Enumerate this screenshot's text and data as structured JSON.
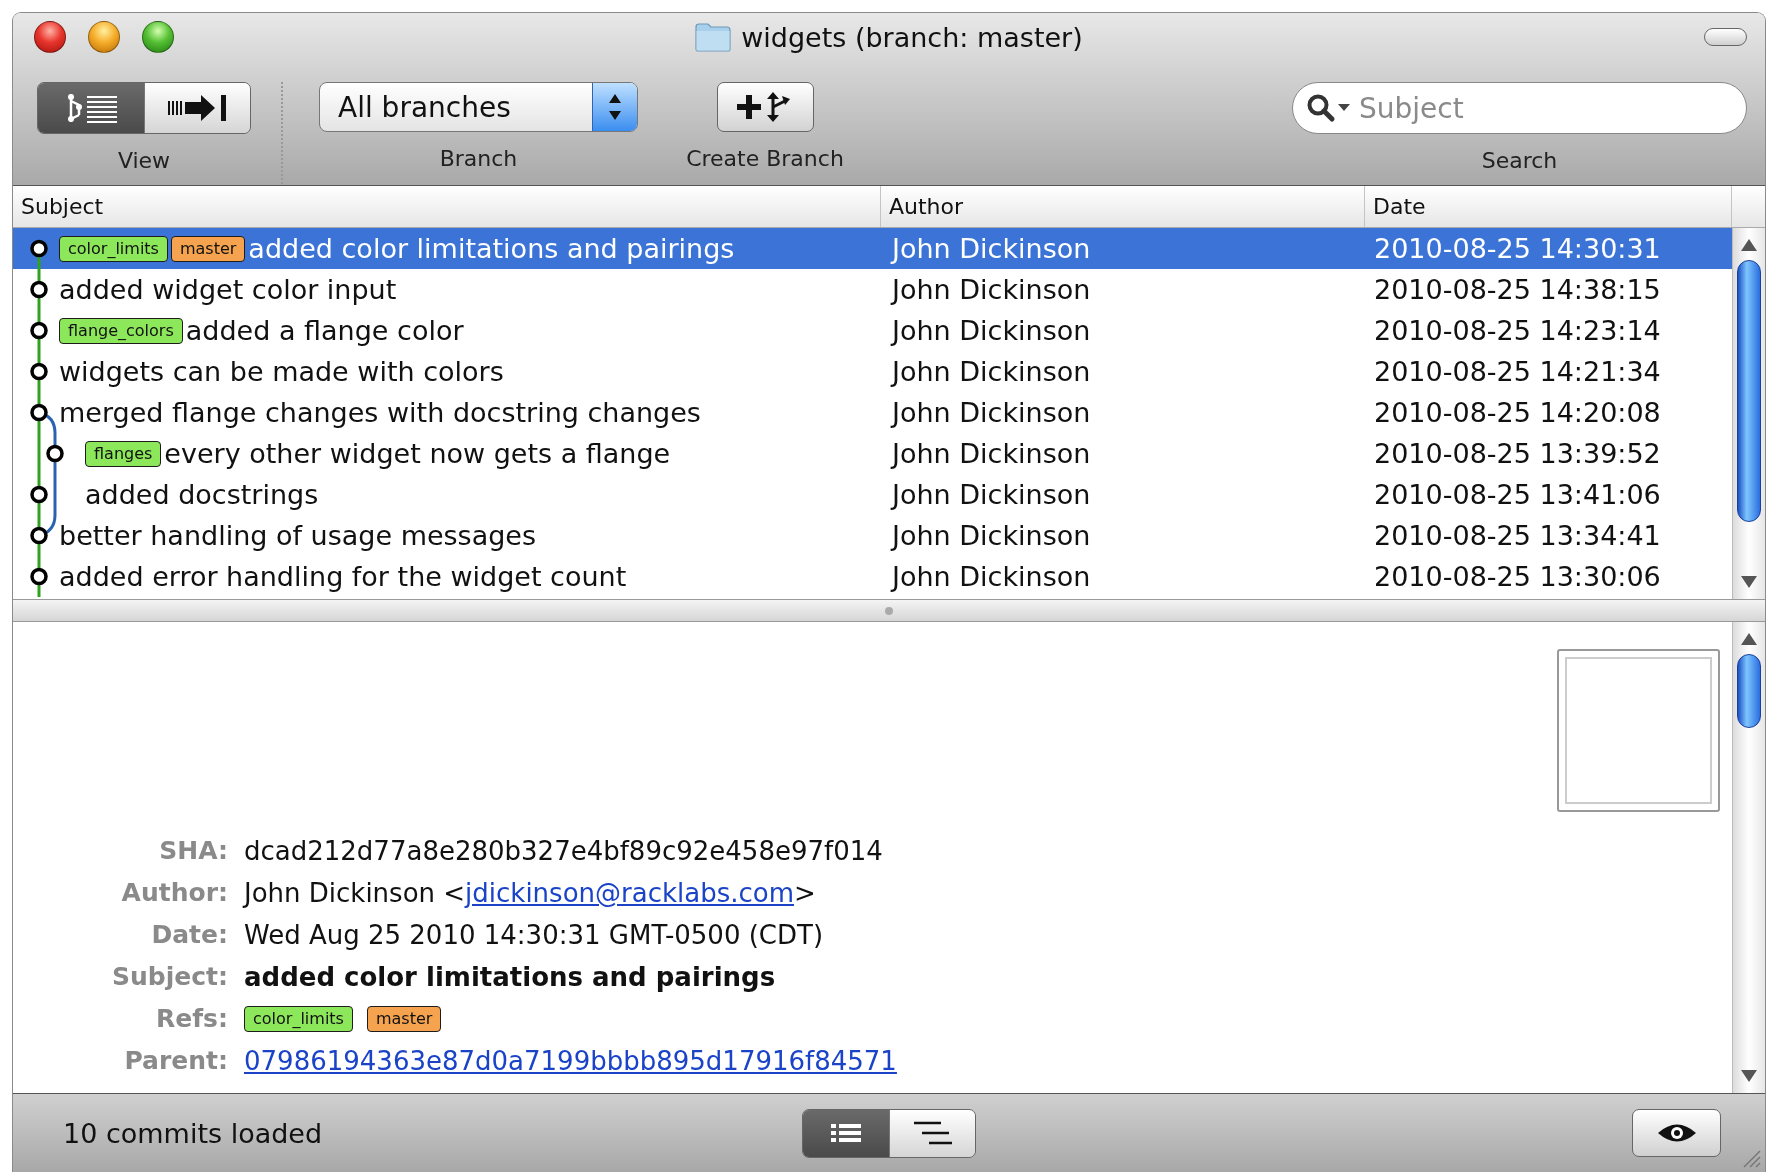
{
  "window": {
    "title": "widgets (branch: master)"
  },
  "toolbar": {
    "view": {
      "label": "View",
      "segments": [
        {
          "kind": "history",
          "selected": true
        },
        {
          "kind": "commit",
          "selected": false
        }
      ]
    },
    "branch": {
      "label": "Branch",
      "value": "All branches"
    },
    "create_branch": {
      "label": "Create Branch"
    },
    "search": {
      "label": "Search",
      "placeholder": "Subject"
    }
  },
  "commit_list": {
    "columns": [
      "Subject",
      "Author",
      "Date"
    ],
    "rows": [
      {
        "refs": [
          {
            "name": "color_limits",
            "color": "#8ce85a"
          },
          {
            "name": "master",
            "color": "#f6a34f"
          }
        ],
        "subject": "added color limitations and pairings",
        "author": "John Dickinson",
        "date": "2010-08-25 14:30:31",
        "selected": true
      },
      {
        "refs": [],
        "subject": "added widget color input",
        "author": "John Dickinson",
        "date": "2010-08-25 14:38:15",
        "selected": false
      },
      {
        "refs": [
          {
            "name": "flange_colors",
            "color": "#8ce85a"
          }
        ],
        "subject": "added a flange color",
        "author": "John Dickinson",
        "date": "2010-08-25 14:23:14",
        "selected": false
      },
      {
        "refs": [],
        "subject": "widgets can be made with colors",
        "author": "John Dickinson",
        "date": "2010-08-25 14:21:34",
        "selected": false
      },
      {
        "refs": [],
        "subject": "merged flange changes with docstring changes",
        "author": "John Dickinson",
        "date": "2010-08-25 14:20:08",
        "selected": false
      },
      {
        "refs": [
          {
            "name": "flanges",
            "color": "#8ce85a"
          }
        ],
        "subject": "every other widget now gets a flange",
        "author": "John Dickinson",
        "date": "2010-08-25 13:39:52",
        "selected": false
      },
      {
        "refs": [],
        "subject": "added docstrings",
        "author": "John Dickinson",
        "date": "2010-08-25 13:41:06",
        "selected": false
      },
      {
        "refs": [],
        "subject": "better handling of usage messages",
        "author": "John Dickinson",
        "date": "2010-08-25 13:34:41",
        "selected": false
      },
      {
        "refs": [],
        "subject": "added error handling for the widget count",
        "author": "John Dickinson",
        "date": "2010-08-25 13:30:06",
        "selected": false
      }
    ]
  },
  "details": {
    "fields": [
      {
        "label": "SHA:",
        "kind": "text",
        "value": "dcad212d77a8e280b327e4bf89c92e458e97f014"
      },
      {
        "label": "Author:",
        "kind": "email",
        "parts": [
          {
            "text": "John Dickinson <"
          },
          {
            "link": "jdickinson@racklabs.com"
          },
          {
            "text": ">"
          }
        ]
      },
      {
        "label": "Date:",
        "kind": "text",
        "value": "Wed Aug 25 2010 14:30:31 GMT-0500 (CDT)"
      },
      {
        "label": "Subject:",
        "kind": "bold",
        "value": "added color limitations and pairings"
      },
      {
        "label": "Refs:",
        "kind": "refs",
        "refs": [
          {
            "name": "color_limits",
            "color": "#8ce85a"
          },
          {
            "name": "master",
            "color": "#f6a34f"
          }
        ]
      },
      {
        "label": "Parent:",
        "kind": "link",
        "value": "07986194363e87d0a7199bbbb895d17916f84571"
      }
    ]
  },
  "status_bar": {
    "text": "10 commits loaded",
    "view_segments": [
      {
        "kind": "list",
        "selected": true
      },
      {
        "kind": "tree",
        "selected": false
      }
    ]
  }
}
